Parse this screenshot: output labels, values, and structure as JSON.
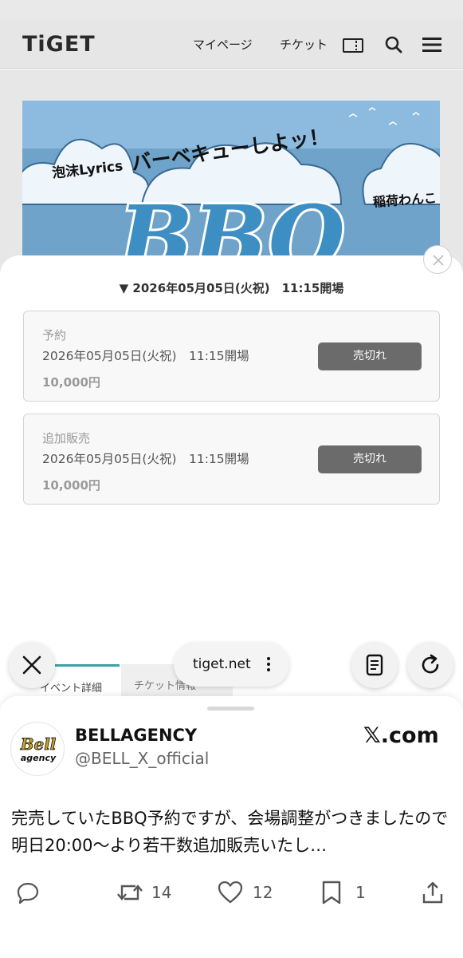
{
  "site": {
    "logo": "TiGET",
    "nav": {
      "mypage": "マイページ",
      "ticket": "チケット"
    }
  },
  "hero": {
    "title": "BBQ",
    "tagline": "バーベキューしよッ！",
    "artist_left": "泡沫Lyrics",
    "artist_right": "稲荷わんこ"
  },
  "modal": {
    "date_toggle": "▼ 2026年05月05日(火祝)　11:15開場",
    "tickets": [
      {
        "name": "予約",
        "datetime": "2026年05月05日(火祝)　11:15開場",
        "price": "10,000円",
        "status": "売切れ"
      },
      {
        "name": "追加販売",
        "datetime": "2026年05月05日(火祝)　11:15開場",
        "price": "10,000円",
        "status": "売切れ"
      }
    ]
  },
  "tabs": {
    "detail": "イベント詳細",
    "ticket": "チケット情報"
  },
  "browser": {
    "url": "tiget.net"
  },
  "post": {
    "display_name": "BELLAGENCY",
    "handle": "@BELL_X_official",
    "source": "𝕏.com",
    "avatar_text": "Bell agency",
    "text": "完売していたBBQ予約ですが、会場調整がつきましたので明日20:00〜より若干数追加販売いたし…",
    "reposts": "14",
    "likes": "12",
    "bookmarks": "1"
  },
  "colors": {
    "accent_tab": "#3aa2a0",
    "soldout_bg": "#6b6b6b",
    "hero_sky": "#6fa3c9"
  }
}
